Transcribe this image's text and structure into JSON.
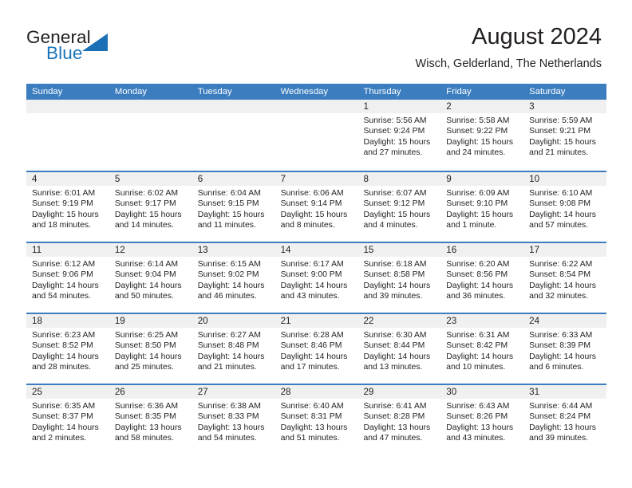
{
  "brand": {
    "general": "General",
    "blue": "Blue",
    "triangle_color": "#1b6fb5",
    "blue_color": "#1b75bb"
  },
  "header": {
    "title": "August 2024",
    "subtitle": "Wisch, Gelderland, The Netherlands"
  },
  "theme": {
    "header_band": "#3b7dbf",
    "day_head_bg": "#f0f0f0",
    "text": "#231f20"
  },
  "weekdays": [
    "Sunday",
    "Monday",
    "Tuesday",
    "Wednesday",
    "Thursday",
    "Friday",
    "Saturday"
  ],
  "weeks": [
    [
      {
        "day": "",
        "lines": []
      },
      {
        "day": "",
        "lines": []
      },
      {
        "day": "",
        "lines": []
      },
      {
        "day": "",
        "lines": []
      },
      {
        "day": "1",
        "lines": [
          "Sunrise: 5:56 AM",
          "Sunset: 9:24 PM",
          "Daylight: 15 hours",
          "and 27 minutes."
        ]
      },
      {
        "day": "2",
        "lines": [
          "Sunrise: 5:58 AM",
          "Sunset: 9:22 PM",
          "Daylight: 15 hours",
          "and 24 minutes."
        ]
      },
      {
        "day": "3",
        "lines": [
          "Sunrise: 5:59 AM",
          "Sunset: 9:21 PM",
          "Daylight: 15 hours",
          "and 21 minutes."
        ]
      }
    ],
    [
      {
        "day": "4",
        "lines": [
          "Sunrise: 6:01 AM",
          "Sunset: 9:19 PM",
          "Daylight: 15 hours",
          "and 18 minutes."
        ]
      },
      {
        "day": "5",
        "lines": [
          "Sunrise: 6:02 AM",
          "Sunset: 9:17 PM",
          "Daylight: 15 hours",
          "and 14 minutes."
        ]
      },
      {
        "day": "6",
        "lines": [
          "Sunrise: 6:04 AM",
          "Sunset: 9:15 PM",
          "Daylight: 15 hours",
          "and 11 minutes."
        ]
      },
      {
        "day": "7",
        "lines": [
          "Sunrise: 6:06 AM",
          "Sunset: 9:14 PM",
          "Daylight: 15 hours",
          "and 8 minutes."
        ]
      },
      {
        "day": "8",
        "lines": [
          "Sunrise: 6:07 AM",
          "Sunset: 9:12 PM",
          "Daylight: 15 hours",
          "and 4 minutes."
        ]
      },
      {
        "day": "9",
        "lines": [
          "Sunrise: 6:09 AM",
          "Sunset: 9:10 PM",
          "Daylight: 15 hours",
          "and 1 minute."
        ]
      },
      {
        "day": "10",
        "lines": [
          "Sunrise: 6:10 AM",
          "Sunset: 9:08 PM",
          "Daylight: 14 hours",
          "and 57 minutes."
        ]
      }
    ],
    [
      {
        "day": "11",
        "lines": [
          "Sunrise: 6:12 AM",
          "Sunset: 9:06 PM",
          "Daylight: 14 hours",
          "and 54 minutes."
        ]
      },
      {
        "day": "12",
        "lines": [
          "Sunrise: 6:14 AM",
          "Sunset: 9:04 PM",
          "Daylight: 14 hours",
          "and 50 minutes."
        ]
      },
      {
        "day": "13",
        "lines": [
          "Sunrise: 6:15 AM",
          "Sunset: 9:02 PM",
          "Daylight: 14 hours",
          "and 46 minutes."
        ]
      },
      {
        "day": "14",
        "lines": [
          "Sunrise: 6:17 AM",
          "Sunset: 9:00 PM",
          "Daylight: 14 hours",
          "and 43 minutes."
        ]
      },
      {
        "day": "15",
        "lines": [
          "Sunrise: 6:18 AM",
          "Sunset: 8:58 PM",
          "Daylight: 14 hours",
          "and 39 minutes."
        ]
      },
      {
        "day": "16",
        "lines": [
          "Sunrise: 6:20 AM",
          "Sunset: 8:56 PM",
          "Daylight: 14 hours",
          "and 36 minutes."
        ]
      },
      {
        "day": "17",
        "lines": [
          "Sunrise: 6:22 AM",
          "Sunset: 8:54 PM",
          "Daylight: 14 hours",
          "and 32 minutes."
        ]
      }
    ],
    [
      {
        "day": "18",
        "lines": [
          "Sunrise: 6:23 AM",
          "Sunset: 8:52 PM",
          "Daylight: 14 hours",
          "and 28 minutes."
        ]
      },
      {
        "day": "19",
        "lines": [
          "Sunrise: 6:25 AM",
          "Sunset: 8:50 PM",
          "Daylight: 14 hours",
          "and 25 minutes."
        ]
      },
      {
        "day": "20",
        "lines": [
          "Sunrise: 6:27 AM",
          "Sunset: 8:48 PM",
          "Daylight: 14 hours",
          "and 21 minutes."
        ]
      },
      {
        "day": "21",
        "lines": [
          "Sunrise: 6:28 AM",
          "Sunset: 8:46 PM",
          "Daylight: 14 hours",
          "and 17 minutes."
        ]
      },
      {
        "day": "22",
        "lines": [
          "Sunrise: 6:30 AM",
          "Sunset: 8:44 PM",
          "Daylight: 14 hours",
          "and 13 minutes."
        ]
      },
      {
        "day": "23",
        "lines": [
          "Sunrise: 6:31 AM",
          "Sunset: 8:42 PM",
          "Daylight: 14 hours",
          "and 10 minutes."
        ]
      },
      {
        "day": "24",
        "lines": [
          "Sunrise: 6:33 AM",
          "Sunset: 8:39 PM",
          "Daylight: 14 hours",
          "and 6 minutes."
        ]
      }
    ],
    [
      {
        "day": "25",
        "lines": [
          "Sunrise: 6:35 AM",
          "Sunset: 8:37 PM",
          "Daylight: 14 hours",
          "and 2 minutes."
        ]
      },
      {
        "day": "26",
        "lines": [
          "Sunrise: 6:36 AM",
          "Sunset: 8:35 PM",
          "Daylight: 13 hours",
          "and 58 minutes."
        ]
      },
      {
        "day": "27",
        "lines": [
          "Sunrise: 6:38 AM",
          "Sunset: 8:33 PM",
          "Daylight: 13 hours",
          "and 54 minutes."
        ]
      },
      {
        "day": "28",
        "lines": [
          "Sunrise: 6:40 AM",
          "Sunset: 8:31 PM",
          "Daylight: 13 hours",
          "and 51 minutes."
        ]
      },
      {
        "day": "29",
        "lines": [
          "Sunrise: 6:41 AM",
          "Sunset: 8:28 PM",
          "Daylight: 13 hours",
          "and 47 minutes."
        ]
      },
      {
        "day": "30",
        "lines": [
          "Sunrise: 6:43 AM",
          "Sunset: 8:26 PM",
          "Daylight: 13 hours",
          "and 43 minutes."
        ]
      },
      {
        "day": "31",
        "lines": [
          "Sunrise: 6:44 AM",
          "Sunset: 8:24 PM",
          "Daylight: 13 hours",
          "and 39 minutes."
        ]
      }
    ]
  ]
}
